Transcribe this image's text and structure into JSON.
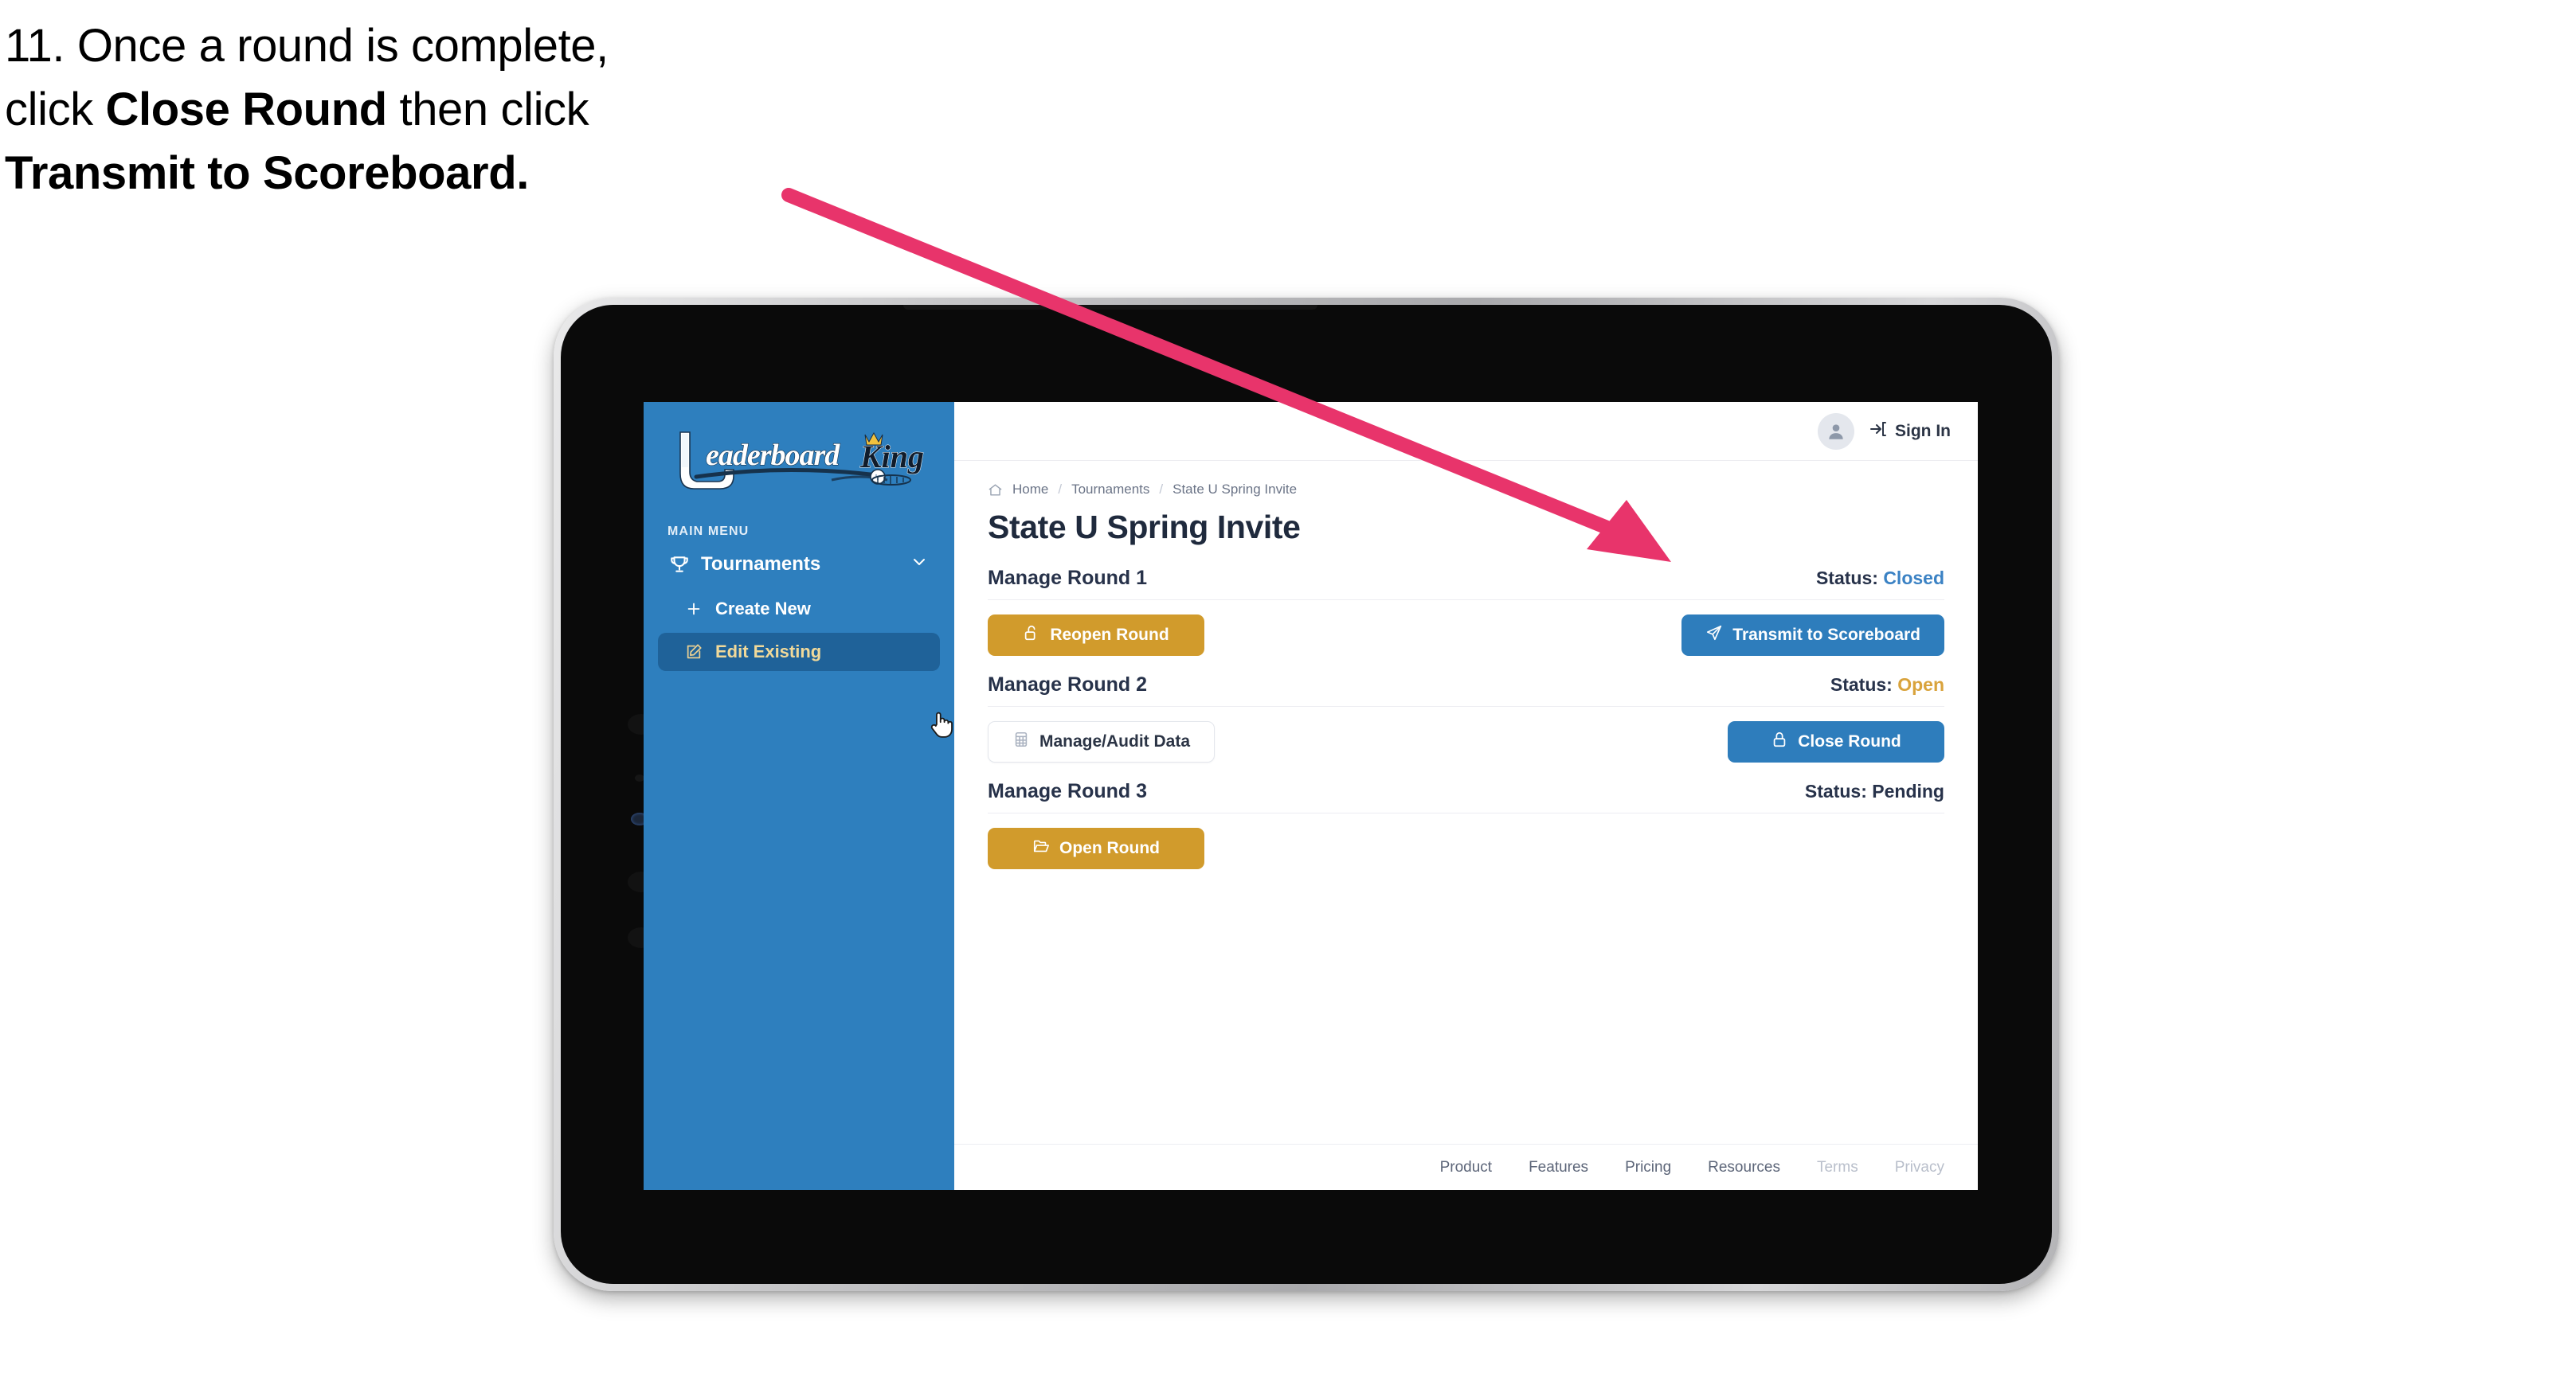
{
  "caption": {
    "line1_prefix": "11. Once a round is complete,",
    "line2_prefix": "click ",
    "line2_bold": "Close Round",
    "line2_suffix": " then click",
    "line3_bold": "Transmit to Scoreboard."
  },
  "annotation": {
    "arrow_color": "#e8346b",
    "points_to": "Transmit to Scoreboard"
  },
  "app": {
    "sidebar": {
      "logo_primary": "Leaderboard",
      "logo_secondary": "King",
      "menu_label": "MAIN MENU",
      "items": [
        {
          "label": "Tournaments",
          "icon": "trophy-icon",
          "expand_icon": "chevron-down-icon",
          "active": false
        },
        {
          "label": "Create New",
          "icon": "plus-icon",
          "active": false
        },
        {
          "label": "Edit Existing",
          "icon": "edit-square-icon",
          "active": true
        }
      ],
      "bg_color": "#2e7fbe",
      "active_bg_color": "#1f6299",
      "active_text_color": "#f0d99a"
    },
    "topbar": {
      "avatar_icon": "user-avatar-icon",
      "signin_icon": "sign-in-arrow-icon",
      "signin_label": "Sign In"
    },
    "breadcrumb": {
      "home_icon": "home-icon",
      "items": [
        "Home",
        "Tournaments",
        "State U Spring Invite"
      ],
      "separator": "/"
    },
    "page_title": "State U Spring Invite",
    "rounds": [
      {
        "name": "Manage Round 1",
        "status_label": "Status:",
        "status_value": "Closed",
        "status_color": "#3b82c4",
        "left_button": {
          "label": "Reopen Round",
          "icon": "unlock-icon",
          "style": "gold"
        },
        "right_button": {
          "label": "Transmit to Scoreboard",
          "icon": "paper-plane-icon",
          "style": "blue"
        }
      },
      {
        "name": "Manage Round 2",
        "status_label": "Status:",
        "status_value": "Open",
        "status_color": "#d9a33c",
        "left_button": {
          "label": "Manage/Audit Data",
          "icon": "table-grid-icon",
          "style": "ghost"
        },
        "right_button": {
          "label": "Close Round",
          "icon": "lock-icon",
          "style": "blue"
        }
      },
      {
        "name": "Manage Round 3",
        "status_label": "Status:",
        "status_value": "Pending",
        "status_color": "#27324a",
        "left_button": {
          "label": "Open Round",
          "icon": "open-folder-icon",
          "style": "gold"
        },
        "right_button": null
      }
    ],
    "footer": {
      "links": [
        {
          "label": "Product",
          "muted": false
        },
        {
          "label": "Features",
          "muted": false
        },
        {
          "label": "Pricing",
          "muted": false
        },
        {
          "label": "Resources",
          "muted": false
        },
        {
          "label": "Terms",
          "muted": true
        },
        {
          "label": "Privacy",
          "muted": true
        }
      ]
    }
  }
}
